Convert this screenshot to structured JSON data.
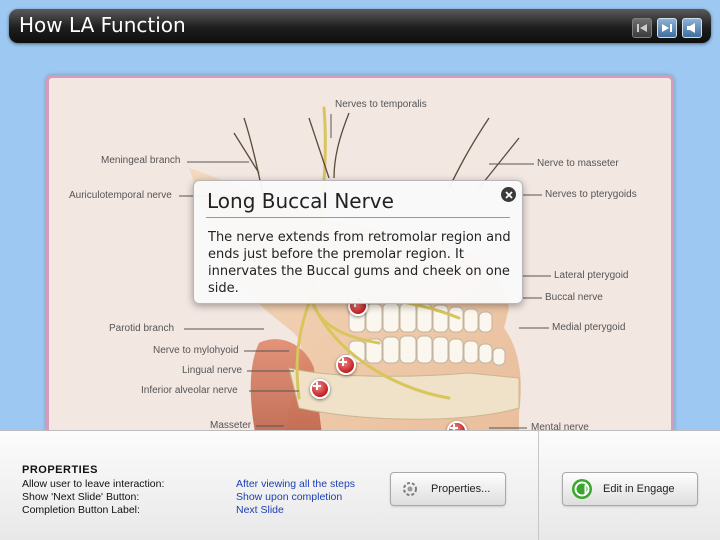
{
  "header": {
    "title": "How LA Function",
    "nav_icons": [
      "previous-icon",
      "next-icon",
      "audio-icon"
    ]
  },
  "diagram": {
    "labels_left": [
      "Meningeal branch",
      "Auriculotemporal nerve",
      "Parotid branch",
      "Nerve to mylohyoid",
      "Lingual nerve",
      "Inferior alveolar nerve",
      "Masseter"
    ],
    "labels_right": [
      "Nerve to masseter",
      "Nerves to pterygoids",
      "Lateral pterygoid",
      "Buccal nerve",
      "Medial pterygoid",
      "Mental nerve"
    ],
    "label_top": "Nerves to temporalis"
  },
  "popup": {
    "title": "Long Buccal Nerve",
    "body": "The nerve extends from retromolar region and ends just before the premolar region. It innervates the Buccal  gums and cheek on one side."
  },
  "properties": {
    "heading": "PROPERTIES",
    "rows": [
      {
        "label": "Allow user to leave interaction:",
        "value": "After viewing all the steps"
      },
      {
        "label": "Show 'Next Slide' Button:",
        "value": "Show upon completion"
      },
      {
        "label": "Completion Button Label:",
        "value": "Next Slide"
      }
    ],
    "properties_button": "Properties...",
    "engage_button": "Edit in Engage"
  },
  "colors": {
    "accent_link": "#1a3fb5",
    "hotspot": "#c21e1e",
    "frame_border": "#d79ab8",
    "background": "#9cc8f2"
  }
}
